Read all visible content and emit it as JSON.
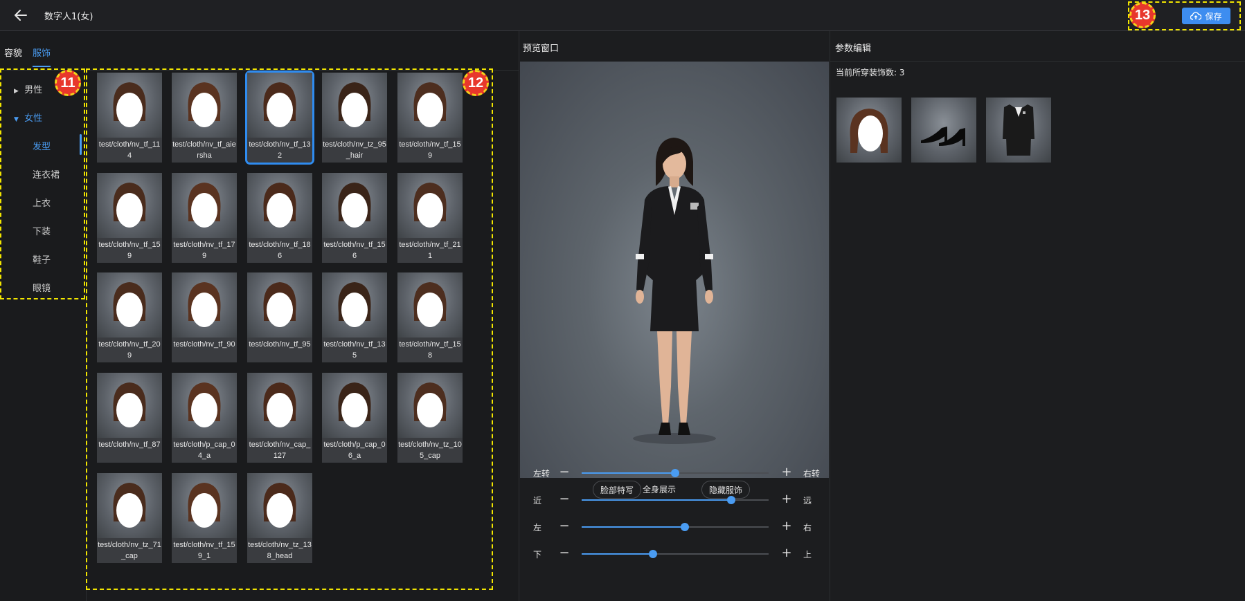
{
  "header": {
    "title": "数字人1(女)",
    "save_label": "保存",
    "marker_13": "13"
  },
  "tabs": [
    {
      "label": "容貌"
    },
    {
      "label": "服饰"
    }
  ],
  "sidebar": {
    "marker": "11",
    "groups": [
      {
        "label": "男性"
      },
      {
        "label": "女性"
      }
    ],
    "items": [
      {
        "label": "发型"
      },
      {
        "label": "连衣裙"
      },
      {
        "label": "上衣"
      },
      {
        "label": "下装"
      },
      {
        "label": "鞋子"
      },
      {
        "label": "眼镜"
      }
    ]
  },
  "grid": {
    "marker": "12",
    "items": [
      {
        "caption": "test/cloth/nv_tf_114"
      },
      {
        "caption": "test/cloth/nv_tf_aiersha"
      },
      {
        "caption": "test/cloth/nv_tf_132"
      },
      {
        "caption": "test/cloth/nv_tz_95_hair"
      },
      {
        "caption": "test/cloth/nv_tf_159"
      },
      {
        "caption": "test/cloth/nv_tf_159"
      },
      {
        "caption": "test/cloth/nv_tf_179"
      },
      {
        "caption": "test/cloth/nv_tf_186"
      },
      {
        "caption": "test/cloth/nv_tf_156"
      },
      {
        "caption": "test/cloth/nv_tf_211"
      },
      {
        "caption": "test/cloth/nv_tf_209"
      },
      {
        "caption": "test/cloth/nv_tf_90"
      },
      {
        "caption": "test/cloth/nv_tf_95"
      },
      {
        "caption": "test/cloth/nv_tf_135"
      },
      {
        "caption": "test/cloth/nv_tf_158"
      },
      {
        "caption": "test/cloth/nv_tf_87"
      },
      {
        "caption": "test/cloth/p_cap_04_a"
      },
      {
        "caption": "test/cloth/nv_cap_127"
      },
      {
        "caption": "test/cloth/p_cap_06_a"
      },
      {
        "caption": "test/cloth/nv_tz_105_cap"
      },
      {
        "caption": "test/cloth/nv_tz_71_cap"
      },
      {
        "caption": "test/cloth/nv_tf_159_1"
      },
      {
        "caption": "test/cloth/nv_tz_138_head"
      }
    ]
  },
  "preview": {
    "title": "预览窗口",
    "chips": {
      "face": "脸部特写",
      "full": "全身展示",
      "hide": "隐藏服饰"
    },
    "sliders": [
      {
        "left": "左转",
        "right": "右转",
        "value": 0.5
      },
      {
        "left": "近",
        "right": "远",
        "value": 0.8
      },
      {
        "left": "左",
        "right": "右",
        "value": 0.55
      },
      {
        "left": "下",
        "right": "上",
        "value": 0.38
      }
    ],
    "minus": "−",
    "plus": "+"
  },
  "params": {
    "title": "参数编辑",
    "count_text": "当前所穿装饰数: 3"
  },
  "colors": {
    "accent": "#4a9cf2",
    "marker": "#e8372c",
    "dash": "#f2e600"
  }
}
